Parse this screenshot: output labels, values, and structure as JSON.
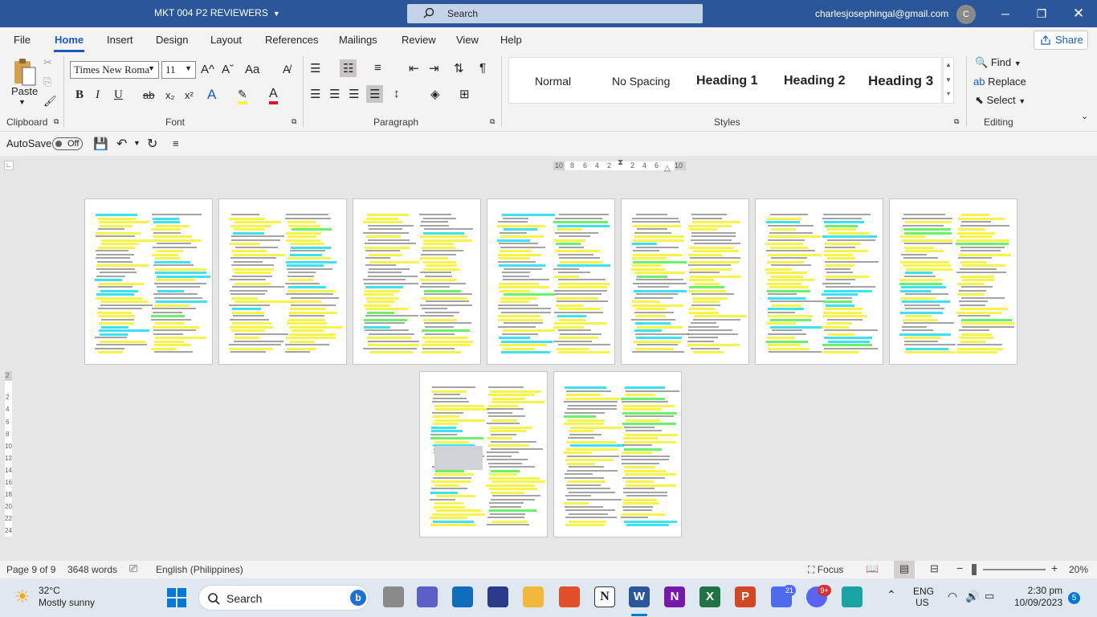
{
  "titlebar": {
    "doc_title": "MKT 004 P2 REVIEWERS",
    "search_label": "Search",
    "account_email": "charlesjosephingal@gmail.com",
    "avatar_initial": "C"
  },
  "menu": {
    "items": [
      "File",
      "Home",
      "Insert",
      "Design",
      "Layout",
      "References",
      "Mailings",
      "Review",
      "View",
      "Help"
    ],
    "active": "Home",
    "share_label": "Share"
  },
  "ribbon": {
    "clipboard": {
      "paste_label": "Paste",
      "group_label": "Clipboard"
    },
    "font": {
      "font_name": "Times New Roma",
      "font_size": "11",
      "group_label": "Font",
      "bold": "B",
      "italic": "I",
      "underline": "U",
      "strike": "ab",
      "subscript": "x₂",
      "superscript": "x²",
      "grow": "A^",
      "shrink": "Aˇ",
      "case": "Aa"
    },
    "paragraph": {
      "group_label": "Paragraph"
    },
    "styles": {
      "items": [
        "Normal",
        "No Spacing",
        "Heading 1",
        "Heading 2",
        "Heading 3"
      ],
      "group_label": "Styles"
    },
    "editing": {
      "find": "Find",
      "replace": "Replace",
      "select": "Select",
      "group_label": "Editing"
    }
  },
  "qat": {
    "autosave_label": "AutoSave",
    "autosave_state": "Off"
  },
  "ruler": {
    "labels": [
      "10",
      "8",
      "6",
      "4",
      "2",
      "2",
      "4",
      "6",
      "10"
    ]
  },
  "vruler": {
    "labels": [
      "2",
      "2",
      "4",
      "6",
      "8",
      "10",
      "12",
      "14",
      "16",
      "18",
      "20",
      "22",
      "24"
    ]
  },
  "status": {
    "page": "Page 9 of 9",
    "words": "3648 words",
    "language": "English (Philippines)",
    "focus": "Focus",
    "zoom": "20%",
    "zoom_minus": "−",
    "zoom_plus": "+"
  },
  "taskbar": {
    "weather_temp": "32°C",
    "weather_desc": "Mostly sunny",
    "search_label": "Search",
    "teams_badge": "21",
    "discord_badge": "9+",
    "lang_top": "ENG",
    "lang_bottom": "US",
    "time": "2:30 pm",
    "date": "10/09/2023",
    "notif_count": "5"
  },
  "colors": {
    "accent": "#2b579a",
    "active_tab": "#185abd",
    "highlight_yellow": "#f7f34a",
    "highlight_cyan": "#3fe0f0"
  }
}
